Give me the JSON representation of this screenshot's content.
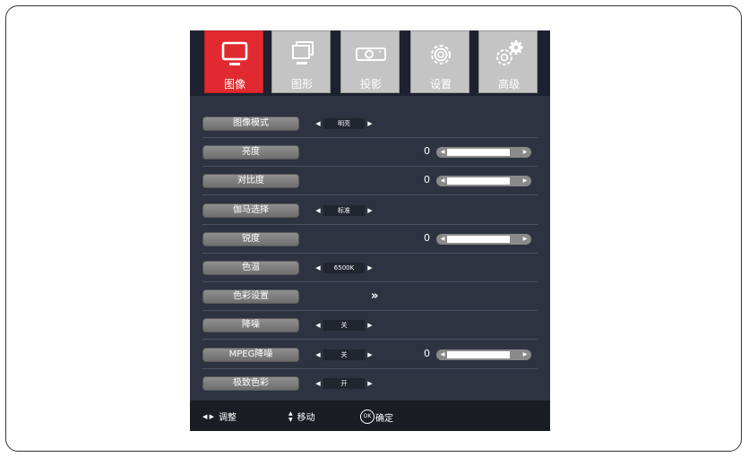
{
  "tabs": [
    {
      "label": "图像",
      "icon": "monitor-icon",
      "active": true
    },
    {
      "label": "图形",
      "icon": "picture-stack-icon",
      "active": false
    },
    {
      "label": "投影",
      "icon": "projector-icon",
      "active": false
    },
    {
      "label": "设置",
      "icon": "gear-icon",
      "active": false
    },
    {
      "label": "高级",
      "icon": "gears-icon",
      "active": false
    }
  ],
  "menu": [
    {
      "label": "图像模式",
      "type": "select",
      "value": "明亮"
    },
    {
      "label": "亮度",
      "type": "slider",
      "value": "0"
    },
    {
      "label": "对比度",
      "type": "slider",
      "value": "0"
    },
    {
      "label": "伽马选择",
      "type": "select",
      "value": "标准"
    },
    {
      "label": "锐度",
      "type": "slider",
      "value": "0"
    },
    {
      "label": "色温",
      "type": "select",
      "value": "6500K"
    },
    {
      "label": "色彩设置",
      "type": "submenu",
      "value": "»"
    },
    {
      "label": "降噪",
      "type": "select",
      "value": "关"
    },
    {
      "label": "MPEG降噪",
      "type": "select-slider",
      "value": "关",
      "slider_value": "0"
    },
    {
      "label": "极致色彩",
      "type": "select",
      "value": "开"
    }
  ],
  "footer": {
    "adjust": "调整",
    "move": "移动",
    "ok_badge": "OK",
    "confirm": "确定"
  },
  "colors": {
    "accent": "#e12a2f",
    "panel": "#2d3340",
    "tab_inactive": "#c4c4c4"
  }
}
